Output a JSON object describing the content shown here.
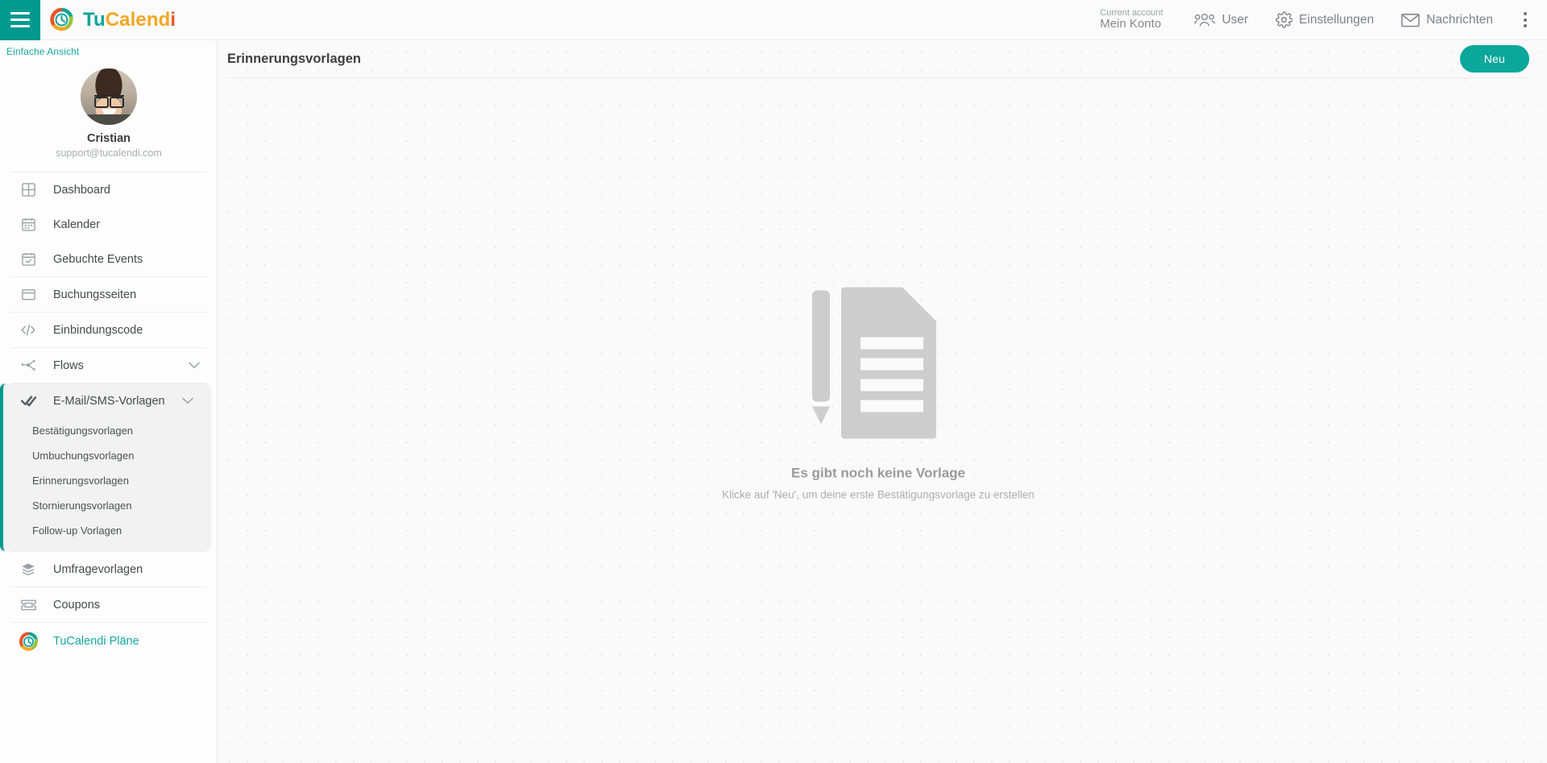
{
  "topbar": {
    "menu_icon": "hamburger-icon",
    "brand": {
      "part1": "Tu",
      "part2": "Calend",
      "part3": "i"
    },
    "account": {
      "label": "Current account",
      "name": "Mein Konto"
    },
    "items": [
      {
        "icon": "users-icon",
        "label": "User"
      },
      {
        "icon": "gear-icon",
        "label": "Einstellungen"
      },
      {
        "icon": "envelope-icon",
        "label": "Nachrichten"
      }
    ],
    "overflow_icon": "kebab-menu-icon"
  },
  "sidebar": {
    "simple_view": "Einfache Ansicht",
    "profile": {
      "name": "Cristian",
      "email": "support@tucalendi.com",
      "avatar": "user-avatar"
    },
    "nav": [
      {
        "icon": "dashboard-icon",
        "label": "Dashboard"
      },
      {
        "icon": "calendar-icon",
        "label": "Kalender"
      },
      {
        "icon": "calendar-check-icon",
        "label": "Gebuchte Events"
      },
      {
        "icon": "window-icon",
        "label": "Buchungsseiten"
      },
      {
        "icon": "code-icon",
        "label": "Einbindungscode"
      },
      {
        "icon": "flow-nodes-icon",
        "label": "Flows",
        "chevron": "chevron-down-icon"
      }
    ],
    "templates_group": {
      "icon": "double-check-icon",
      "label": "E-Mail/SMS-Vorlagen",
      "chevron": "chevron-down-icon",
      "items": [
        "Bestätigungsvorlagen",
        "Umbuchungsvorlagen",
        "Erinnerungsvorlagen",
        "Stornierungsvorlagen",
        "Follow-up Vorlagen"
      ],
      "active_item": "Erinnerungsvorlagen"
    },
    "nav_bottom": [
      {
        "icon": "layers-icon",
        "label": "Umfragevorlagen"
      },
      {
        "icon": "coupon-icon",
        "label": "Coupons"
      }
    ],
    "plans": {
      "icon": "tucalendi-logo-icon",
      "label": "TuCalendi Pläne"
    }
  },
  "main": {
    "page_title": "Erinnerungsvorlagen",
    "new_button": "Neu",
    "empty_state": {
      "illustration": "document-with-pencil-icon",
      "title": "Es gibt noch keine Vorlage",
      "subtitle": "Klicke auf 'Neu', um deine erste Bestätigungsvorlage zu erstellen"
    }
  },
  "colors": {
    "accent": "#009a8e",
    "brand_orange": "#f5a623",
    "brand_red": "#e8562a",
    "link": "#15a89d"
  }
}
